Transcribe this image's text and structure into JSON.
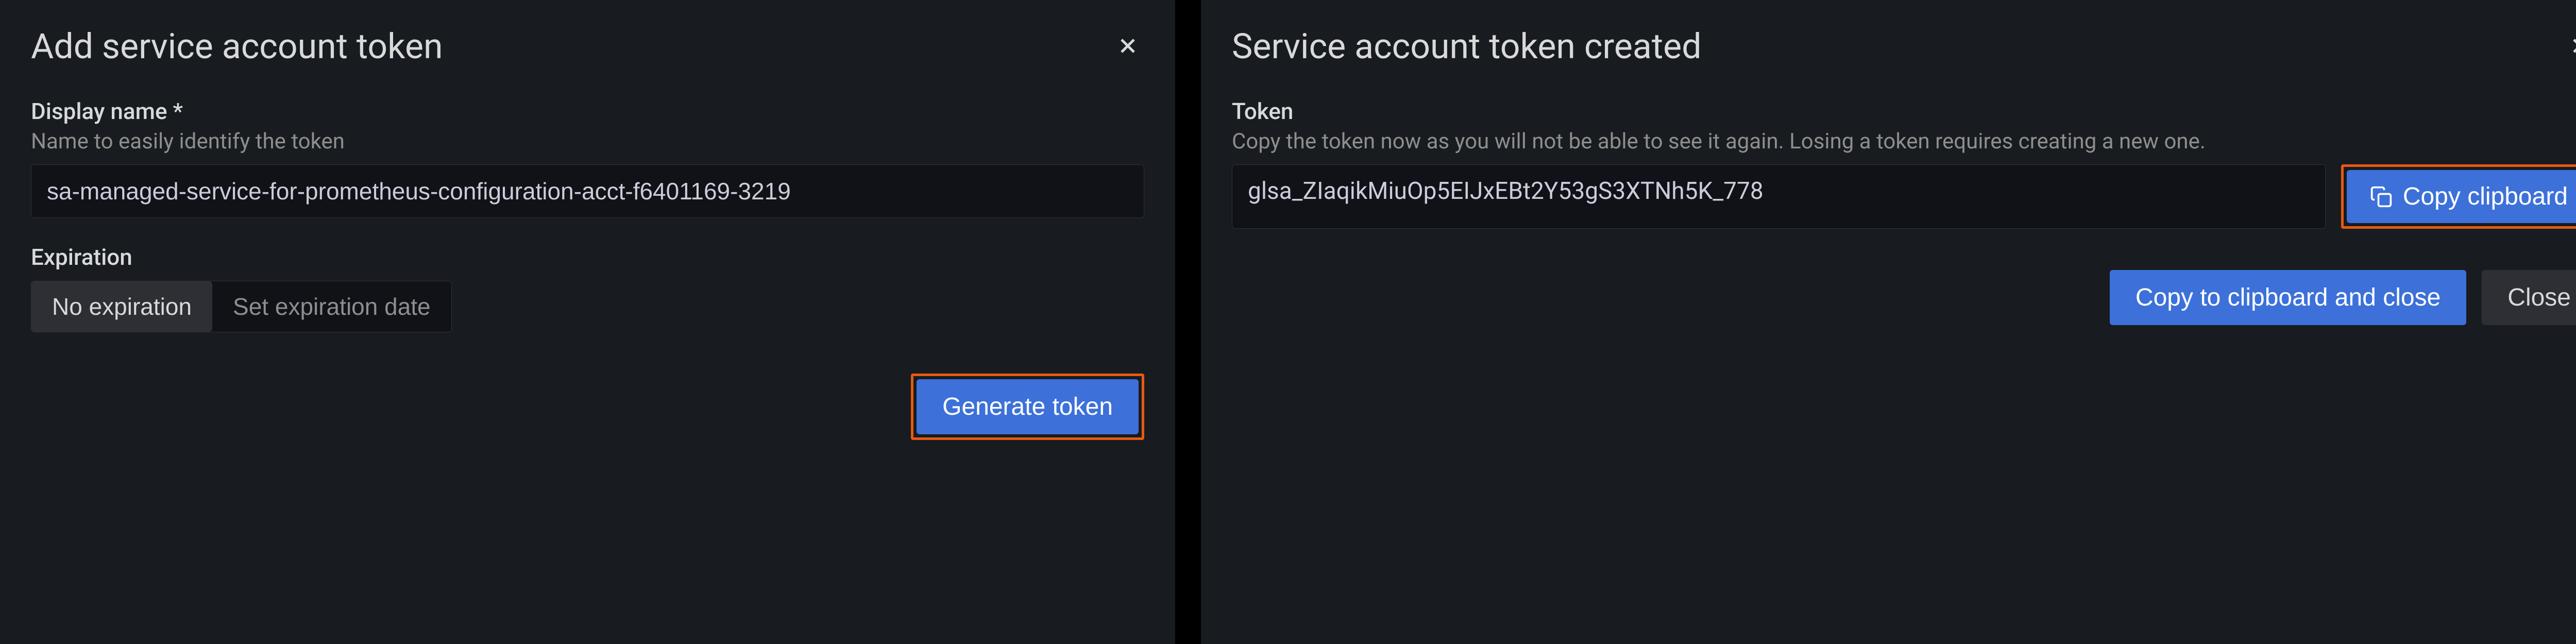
{
  "left": {
    "title": "Add service account token",
    "displayName": {
      "label": "Display name *",
      "hint": "Name to easily identify the token",
      "value": "sa-managed-service-for-prometheus-configuration-acct-f6401169-3219"
    },
    "expiration": {
      "label": "Expiration",
      "options": {
        "noExpiration": "No expiration",
        "setDate": "Set expiration date"
      }
    },
    "generateButton": "Generate token"
  },
  "right": {
    "title": "Service account token created",
    "token": {
      "label": "Token",
      "hint": "Copy the token now as you will not be able to see it again. Losing a token requires creating a new one.",
      "value": "glsa_ZIaqikMiuOp5EIJxEBt2Y53gS3XTNh5K_778"
    },
    "copyButton": "Copy clipboard",
    "copyCloseButton": "Copy to clipboard and close",
    "closeButton": "Close"
  }
}
